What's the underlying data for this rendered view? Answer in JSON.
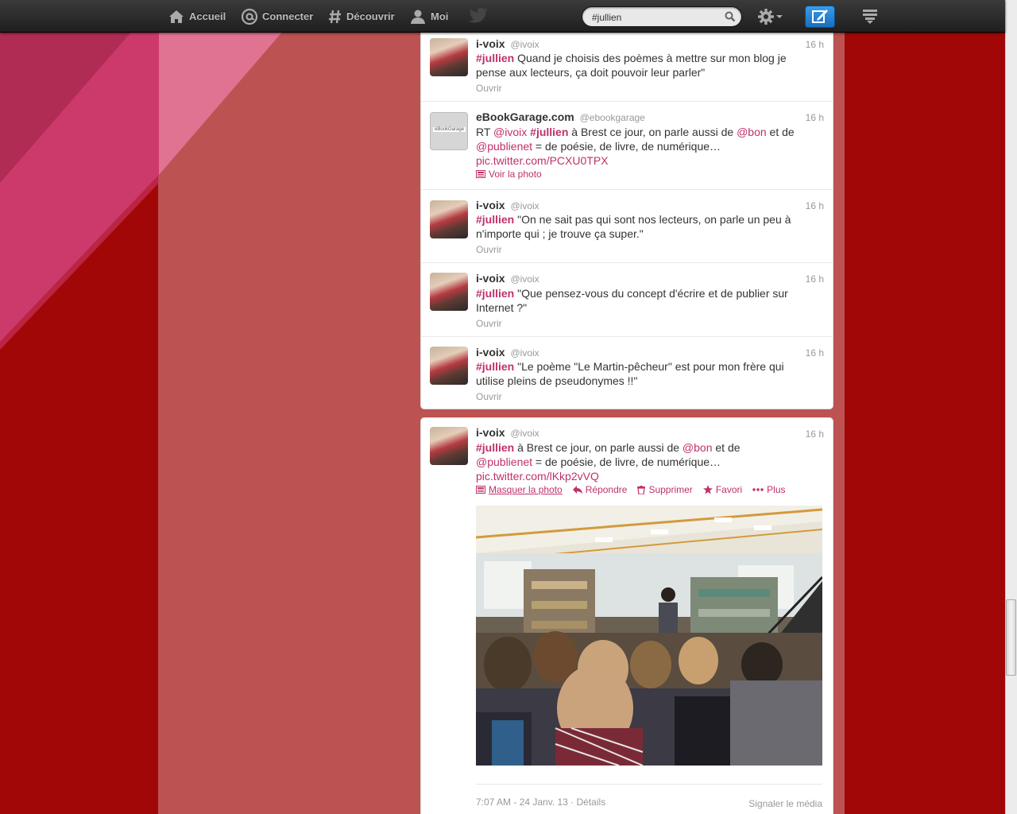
{
  "nav": {
    "home": "Accueil",
    "connect": "Connecter",
    "discover": "Découvrir",
    "me": "Moi"
  },
  "search": {
    "value": "#jullien"
  },
  "tweets": [
    {
      "name": "i-voix",
      "handle": "@ivoix",
      "time": "16 h",
      "hashtag": "#jullien",
      "text": " Quand je choisis des poèmes à mettre sur mon blog je pense aux lecteurs, ça doit pouvoir leur parler\"",
      "open": "Ouvrir"
    },
    {
      "name": "eBookGarage.com",
      "handle": "@ebookgarage",
      "time": "16 h",
      "rt": "RT ",
      "mention1": "@ivoix",
      "hashtag": "#jullien",
      "text1": " à Brest ce jour, on parle aussi de ",
      "mention2": "@bon",
      "text2": " et de ",
      "mention3": "@publienet",
      "text3": " = de poésie, de livre, de numérique…",
      "link": "pic.twitter.com/PCXU0TPX",
      "photo_link": "Voir la photo",
      "avatar_text": "eBookGarage"
    },
    {
      "name": "i-voix",
      "handle": "@ivoix",
      "time": "16 h",
      "hashtag": "#jullien",
      "text": " \"On ne sait pas qui sont nos lecteurs, on parle un peu à n'importe qui ; je trouve ça super.\"",
      "open": "Ouvrir"
    },
    {
      "name": "i-voix",
      "handle": "@ivoix",
      "time": "16 h",
      "hashtag": "#jullien",
      "text": " \"Que pensez-vous du concept d'écrire et de publier sur Internet ?\"",
      "open": "Ouvrir"
    },
    {
      "name": "i-voix",
      "handle": "@ivoix",
      "time": "16 h",
      "hashtag": "#jullien",
      "text": " \"Le poème \"Le Martin-pêcheur\" est pour mon frère qui utilise pleins de pseudonymes !!\"",
      "open": "Ouvrir"
    }
  ],
  "expanded": {
    "name": "i-voix",
    "handle": "@ivoix",
    "time": "16 h",
    "hashtag": "#jullien",
    "text1": " à Brest ce jour, on parle aussi de ",
    "mention1": "@bon",
    "text2": " et de ",
    "mention2": "@publienet",
    "text3": " = de poésie, de livre, de numérique…",
    "link": "pic.twitter.com/lKkp2vVQ",
    "actions": {
      "hide_photo": "Masquer la photo",
      "reply": "Répondre",
      "delete": "Supprimer",
      "favorite": "Favori",
      "more": "Plus"
    },
    "meta": "7:07 AM - 24 Janv. 13 · Détails",
    "report": "Signaler le média"
  },
  "colors": {
    "background": "#a20707",
    "column": "#bc5252",
    "accent": "#c0306a",
    "topbar": "#2a2a2a",
    "compose": "#2a86d6"
  },
  "icons": [
    "home-icon",
    "at-icon",
    "hash-icon",
    "user-icon",
    "twitter-bird-icon",
    "search-icon",
    "gear-icon",
    "compose-icon",
    "stream-icon",
    "photo-icon",
    "reply-icon",
    "trash-icon",
    "star-icon",
    "more-icon"
  ]
}
